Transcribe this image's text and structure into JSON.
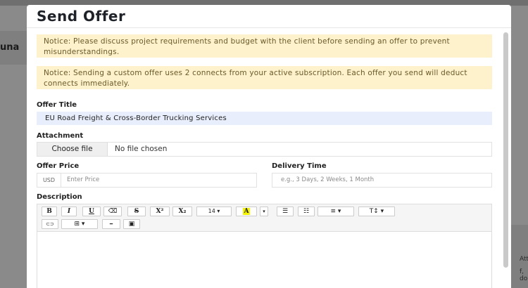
{
  "modal": {
    "title": "Send Offer"
  },
  "notices": [
    "Notice: Please discuss project requirements and budget with the client before sending an offer to prevent misunderstandings.",
    "Notice: Sending a custom offer uses 2 connects from your active subscription. Each offer you send will deduct connects immediately."
  ],
  "form": {
    "offer_title_label": "Offer Title",
    "offer_title_value": "EU Road Freight & Cross-Border Trucking Services",
    "attachment_label": "Attachment",
    "choose_file": "Choose file",
    "file_status": "No file chosen",
    "offer_price_label": "Offer Price",
    "currency": "USD",
    "price_placeholder": "Enter Price",
    "delivery_label": "Delivery Time",
    "delivery_placeholder": "e.g., 3 Days, 2 Weeks, 1 Month",
    "description_label": "Description"
  },
  "toolbar": {
    "bold": "B",
    "italic": "I",
    "underline": "U",
    "eraser": "⌫",
    "strikethrough": "S",
    "superscript": "X²",
    "subscript": "X₂",
    "font_size": "14 ▾",
    "color": "A",
    "color_caret": "▾",
    "ul": "☰",
    "ol": "☷",
    "align": "≡ ▾",
    "line_height": "T↕ ▾",
    "link": "⊂⊃",
    "table": "⊞ ▾",
    "hr": "━",
    "image": "▣"
  },
  "background": {
    "left_text": "una",
    "right_text_1": "Atta",
    "right_text_2": "f, do"
  },
  "colors": {
    "notice_bg": "#fdf2cc",
    "title_input_bg": "#e8eefb",
    "highlight": "#f4f400"
  },
  "icons": {
    "scrollbar": "scrollbar-thumb"
  }
}
